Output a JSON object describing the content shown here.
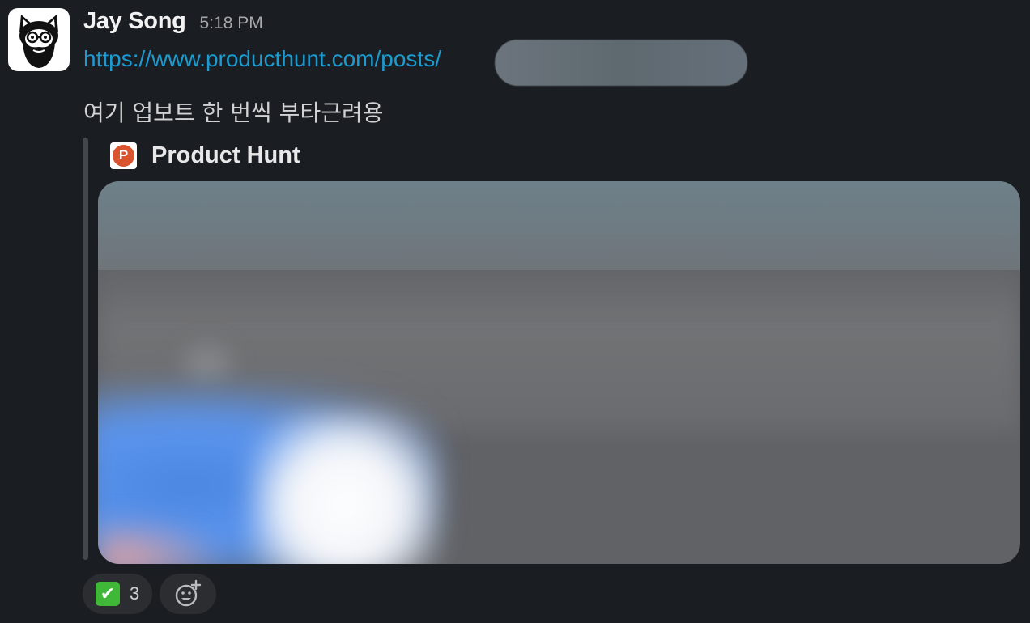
{
  "message": {
    "sender": "Jay Song",
    "timestamp": "5:18 PM",
    "link_text": "https://www.producthunt.com/posts/",
    "body": "여기 업보트 한 번씩 부타근려용"
  },
  "attachment": {
    "service_icon_letter": "P",
    "service_name": "Product Hunt",
    "accent_color": "#da552f"
  },
  "reactions": [
    {
      "emoji": "✔",
      "icon": "white-check-mark",
      "count": "3"
    }
  ],
  "icons": {
    "avatar": "bearded-cat-with-glasses-avatar",
    "add_reaction": "add-reaction-icon"
  },
  "colors": {
    "background": "#1a1d21",
    "link": "#1d9bd1",
    "reaction_bg": "#2b2d31",
    "check_green": "#3fb838"
  }
}
